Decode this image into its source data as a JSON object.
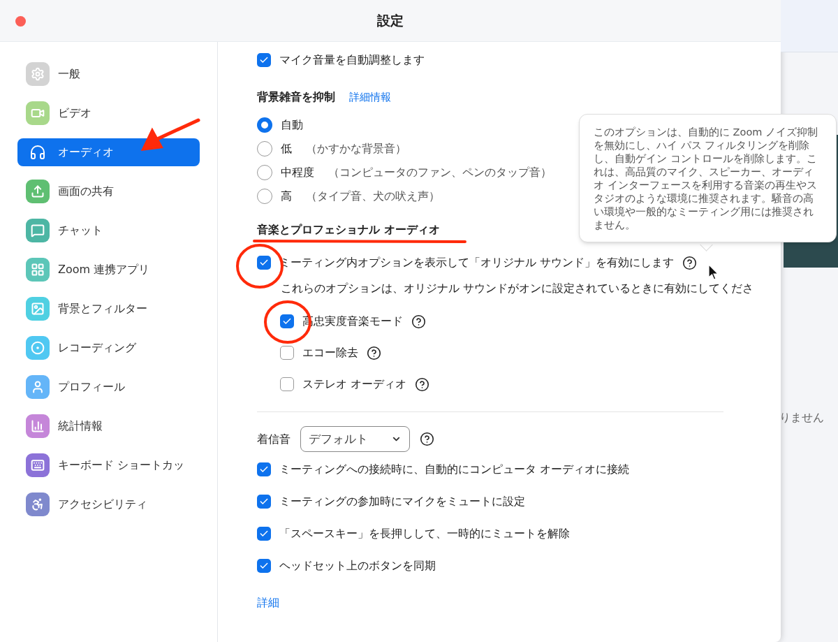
{
  "window": {
    "title": "設定"
  },
  "sidebar": {
    "items": [
      {
        "label": "一般",
        "kind": "gear",
        "color": "#d3d3d3",
        "selected": false
      },
      {
        "label": "ビデオ",
        "kind": "video",
        "color": "#a8d88a",
        "selected": false
      },
      {
        "label": "オーディオ",
        "kind": "headphones",
        "color": "#0e72ed",
        "selected": true
      },
      {
        "label": "画面の共有",
        "kind": "share",
        "color": "#5fbf72",
        "selected": false
      },
      {
        "label": "チャット",
        "kind": "chat",
        "color": "#4db6a4",
        "selected": false
      },
      {
        "label": "Zoom 連携アプリ",
        "kind": "apps",
        "color": "#5cc6b8",
        "selected": false
      },
      {
        "label": "背景とフィルター",
        "kind": "background",
        "color": "#4fd0e2",
        "selected": false
      },
      {
        "label": "レコーディング",
        "kind": "recording",
        "color": "#50c8f2",
        "selected": false
      },
      {
        "label": "プロフィール",
        "kind": "profile",
        "color": "#64b5f8",
        "selected": false
      },
      {
        "label": "統計情報",
        "kind": "stats",
        "color": "#c586d9",
        "selected": false
      },
      {
        "label": "キーボード ショートカッ",
        "kind": "keyboard",
        "color": "#8c72d8",
        "selected": false
      },
      {
        "label": "アクセシビリティ",
        "kind": "accessibility",
        "color": "#7f89cd",
        "selected": false
      }
    ]
  },
  "audio": {
    "auto_mic": {
      "label": "マイク音量を自動調整します",
      "checked": true
    },
    "noise": {
      "title": "背景雑音を抑制",
      "link": "詳細情報",
      "options": [
        {
          "label": "自動",
          "selected": true
        },
        {
          "label": "低",
          "note": "（かすかな背景音）",
          "selected": false
        },
        {
          "label": "中程度",
          "note": "（コンピュータのファン、ペンのタップ音）",
          "selected": false
        },
        {
          "label": "高",
          "note": "（タイプ音、犬の吠え声）",
          "selected": false
        }
      ]
    },
    "music": {
      "title": "音楽とプロフェショナル オーディオ",
      "original_sound": {
        "label": "ミーティング内オプションを表示して「オリジナル サウンド」を有効にします",
        "checked": true
      },
      "note": "これらのオプションは、オリジナル サウンドがオンに設定されているときに有効にしてくださ",
      "options": [
        {
          "label": "高忠実度音楽モード",
          "checked": true
        },
        {
          "label": "エコー除去",
          "checked": false
        },
        {
          "label": "ステレオ オーディオ",
          "checked": false
        }
      ]
    },
    "ringtone": {
      "label": "着信音",
      "value": "デフォルト"
    },
    "options": [
      {
        "label": "ミーティングへの接続時に、自動的にコンピュータ オーディオに接続",
        "checked": true
      },
      {
        "label": "ミーティングの参加時にマイクをミュートに設定",
        "checked": true
      },
      {
        "label": "「スペースキー」を長押しして、一時的にミュートを解除",
        "checked": true
      },
      {
        "label": "ヘッドセット上のボタンを同期",
        "checked": true
      }
    ],
    "more_link": "詳細"
  },
  "tooltip": {
    "text": "このオプションは、自動的に Zoom ノイズ抑制を無効にし、ハイ パス フィルタリングを削除し、自動ゲイン コントロールを削除します。これは、高品質のマイク、スピーカー、オーディオ インターフェースを利用する音楽の再生やスタジオのような環境に推奨されます。騒音の高い環境や一般的なミーティング用には推奨されません。"
  },
  "background_window": {
    "text": "りません"
  }
}
